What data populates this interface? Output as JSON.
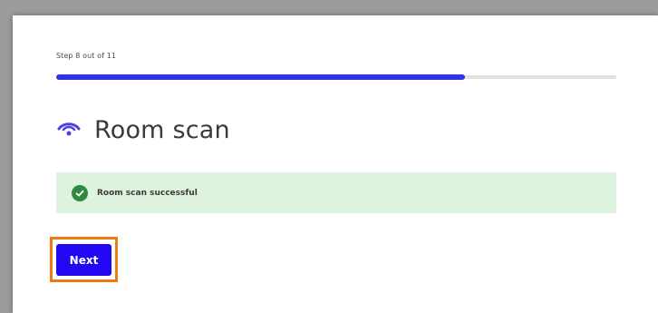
{
  "stepper": {
    "label": "Step 8 out of 11",
    "progress_fraction": 0.73
  },
  "header": {
    "title": "Room scan",
    "icon": "eye-icon"
  },
  "alert": {
    "status": "success",
    "icon": "check-circle-icon",
    "message": "Room scan successful"
  },
  "actions": {
    "next_label": "Next"
  },
  "colors": {
    "accent": "#2407f2",
    "progress": "#3333e6",
    "success_bg": "#ddf3dd",
    "success_icon": "#2f8a3e",
    "highlight": "#ee7a16"
  }
}
